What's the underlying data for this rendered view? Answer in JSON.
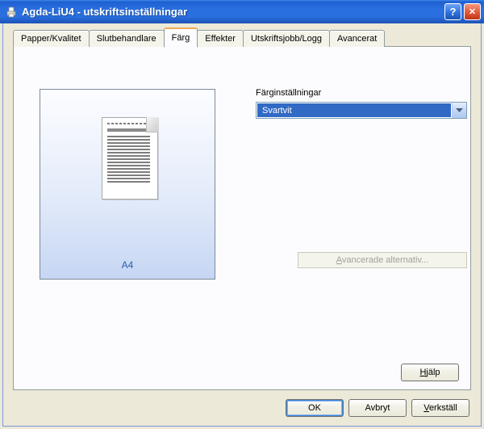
{
  "window": {
    "title": "Agda-LiU4 - utskriftsinställningar",
    "help_symbol": "?",
    "close_symbol": "✕"
  },
  "tabs": {
    "paper": "Papper/Kvalitet",
    "finish": "Slutbehandlare",
    "color": "Färg",
    "effects": "Effekter",
    "jobs": "Utskriftsjobb/Logg",
    "adv": "Avancerat"
  },
  "preview": {
    "paper_label": "A4"
  },
  "color_settings": {
    "group_label": "Färginställningar",
    "selected": "Svartvit"
  },
  "advanced_button": {
    "ul": "A",
    "rest": "vancerade alternativ..."
  },
  "help_button": {
    "ul": "H",
    "rest": "jälp"
  },
  "buttons": {
    "ok": "OK",
    "cancel": "Avbryt",
    "apply_ul": "V",
    "apply_rest": "erkställ"
  }
}
